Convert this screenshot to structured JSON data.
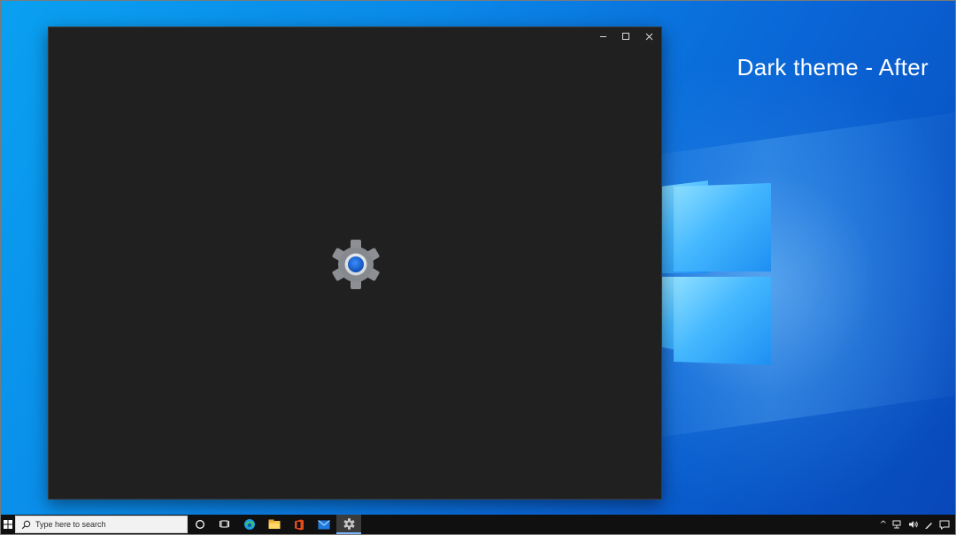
{
  "desktop": {
    "caption": "Dark theme - After"
  },
  "window": {
    "controls": {
      "minimize_icon": "minimize-icon",
      "maximize_icon": "maximize-icon",
      "close_icon": "close-icon"
    },
    "splash_icon": "settings-gear-icon",
    "background_color": "#202020",
    "accent_color": "#1e6fd6"
  },
  "taskbar": {
    "search": {
      "placeholder": "Type here to search"
    },
    "apps": [
      {
        "icon": "cortana-icon"
      },
      {
        "icon": "task-view-icon"
      },
      {
        "icon": "edge-icon"
      },
      {
        "icon": "file-explorer-icon"
      },
      {
        "icon": "office-icon"
      },
      {
        "icon": "mail-icon"
      },
      {
        "icon": "settings-icon",
        "active": true
      }
    ],
    "tray": [
      {
        "icon": "chevron-up-icon"
      },
      {
        "icon": "network-icon"
      },
      {
        "icon": "volume-icon"
      },
      {
        "icon": "pen-icon"
      },
      {
        "icon": "notification-icon"
      }
    ]
  }
}
